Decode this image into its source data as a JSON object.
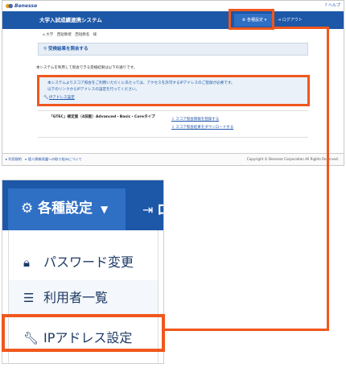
{
  "header": {
    "brand": "Benesse",
    "help": "ヘルプ",
    "app_title": "大学入試成績連携システム",
    "settings_label": "各種設定",
    "logout_label": "ログアウト"
  },
  "user": {
    "line": "大学　西短教授　西短教名　様"
  },
  "panel": {
    "title": "受検結果を照会する"
  },
  "intro": "本システムを利用して照会できる受検結果は以下の通りです。",
  "notice": {
    "line1": "本システムよりスコア照会をご利用いただくにあたっては、アクセスを許可するIPアドレスのご登録が必要です。",
    "line2": "以下のリンクからIPアドレスの設定を行ってください。",
    "link": "IPアドレス設定"
  },
  "tests": [
    {
      "name": "「GTEC」検定版（4技能）Advanced・Basic・Coreタイプ",
      "action1": "スコア照会情報を登録する",
      "action2": "スコア照会結果をダウンロードする"
    }
  ],
  "footer": {
    "links": "▸ 利用規約　▸ 個人情報保護への取り組みについて",
    "copyright": "Copyright © Benesse Corporation All Rights Reserved."
  },
  "zoom": {
    "settings_label": "各種設定",
    "logout_label": "ロ",
    "menu": [
      {
        "label": "パスワード変更",
        "icon": "lock-icon"
      },
      {
        "label": "利用者一覧",
        "icon": "list-icon"
      },
      {
        "label": "IPアドレス設定",
        "icon": "wrench-icon"
      }
    ]
  },
  "colors": {
    "nav": "#1d57a8",
    "accent": "#f0571d",
    "link": "#2255aa"
  }
}
